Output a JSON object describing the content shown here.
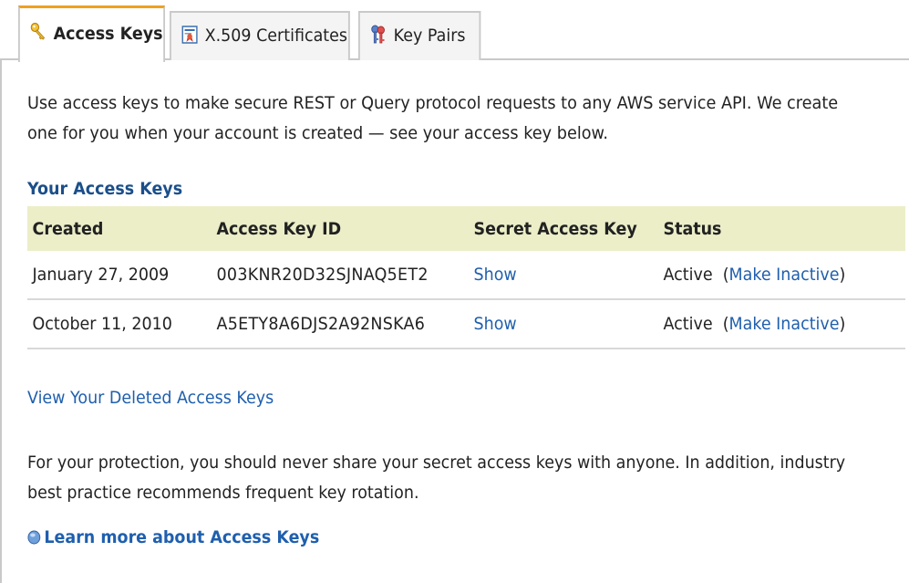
{
  "tabs": {
    "access_keys": "Access Keys",
    "x509": "X.509 Certificates",
    "key_pairs": "Key Pairs",
    "active": "access_keys",
    "icons": {
      "access_keys": "key-icon",
      "x509": "certificate-icon",
      "key_pairs": "key-pair-icon"
    }
  },
  "intro": {
    "text": "Use access keys to make secure REST or Query protocol requests to any AWS service API. We create one for you when your account is created — see your access key below."
  },
  "access_keys_section": {
    "title": "Your Access Keys",
    "columns": [
      "Created",
      "Access Key ID",
      "Secret Access Key",
      "Status"
    ],
    "rows": [
      {
        "created": "January 27, 2009",
        "access_key_id": "003KNR20D32SJNAQ5ET2",
        "secret_action": "Show",
        "status": "Active",
        "status_action": "Make Inactive"
      },
      {
        "created": "October 11, 2010",
        "access_key_id": "A5ETY8A6DJS2A92NSKA6",
        "secret_action": "Show",
        "status": "Active",
        "status_action": "Make Inactive"
      }
    ]
  },
  "deleted_link": "View Your Deleted Access Keys",
  "protection": {
    "text": "For your protection, you should never share your secret access keys with anyone. In addition, industry best practice recommends frequent key rotation."
  },
  "learn_more": {
    "label": "Learn more about Access Keys",
    "icon": "info-icon"
  },
  "colors": {
    "link": "#1f5fae",
    "section_title": "#1b4f8a",
    "active_tab_accent": "#f0a020",
    "table_header_bg": "#eceec8"
  }
}
